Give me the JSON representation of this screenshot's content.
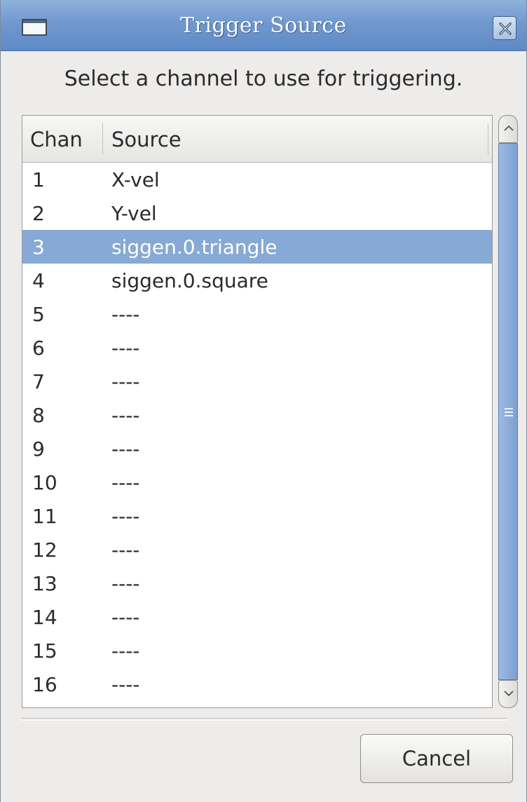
{
  "window": {
    "title": "Trigger Source"
  },
  "instruction": "Select a channel to use for triggering.",
  "list": {
    "columns": [
      "Chan",
      "Source"
    ],
    "rows": [
      {
        "chan": "1",
        "source": "X-vel",
        "selected": false
      },
      {
        "chan": "2",
        "source": "Y-vel",
        "selected": false
      },
      {
        "chan": "3",
        "source": "siggen.0.triangle",
        "selected": true
      },
      {
        "chan": "4",
        "source": "siggen.0.square",
        "selected": false
      },
      {
        "chan": "5",
        "source": "----",
        "selected": false
      },
      {
        "chan": "6",
        "source": "----",
        "selected": false
      },
      {
        "chan": "7",
        "source": "----",
        "selected": false
      },
      {
        "chan": "8",
        "source": "----",
        "selected": false
      },
      {
        "chan": "9",
        "source": "----",
        "selected": false
      },
      {
        "chan": "10",
        "source": "----",
        "selected": false
      },
      {
        "chan": "11",
        "source": "----",
        "selected": false
      },
      {
        "chan": "12",
        "source": "----",
        "selected": false
      },
      {
        "chan": "13",
        "source": "----",
        "selected": false
      },
      {
        "chan": "14",
        "source": "----",
        "selected": false
      },
      {
        "chan": "15",
        "source": "----",
        "selected": false
      },
      {
        "chan": "16",
        "source": "----",
        "selected": false
      }
    ]
  },
  "buttons": {
    "cancel": "Cancel"
  },
  "icons": {
    "window_menu": "window-menu-icon",
    "close": "close-icon",
    "scroll_up": "chevron-up-icon",
    "scroll_down": "chevron-down-icon"
  },
  "colors": {
    "titlebar": "#7199cf",
    "selection": "#86a9d5",
    "scroll_thumb": "#8aabd9"
  }
}
